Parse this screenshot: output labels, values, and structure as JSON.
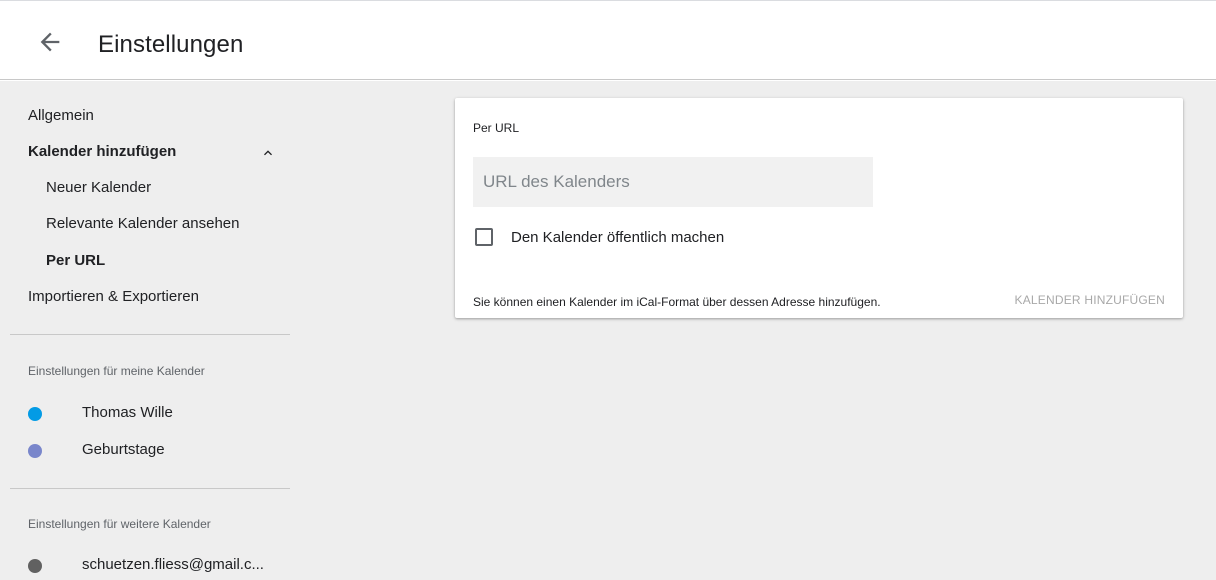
{
  "header": {
    "back_icon": "arrow-back-icon",
    "title": "Einstellungen"
  },
  "sidebar": {
    "items": [
      {
        "label": "Allgemein"
      },
      {
        "label": "Kalender hinzufügen"
      },
      {
        "label": "Neuer Kalender"
      },
      {
        "label": "Relevante Kalender ansehen"
      },
      {
        "label": "Per URL"
      },
      {
        "label": "Importieren & Exportieren"
      }
    ],
    "my_calendars_title": "Einstellungen für meine Kalender",
    "my_calendars": [
      {
        "name": "Thomas Wille",
        "color": "#039be5"
      },
      {
        "name": "Geburtstage",
        "color": "#7986cb"
      }
    ],
    "other_calendars_title": "Einstellungen für weitere Kalender",
    "other_calendars": [
      {
        "name": "schuetzen.fliess@gmail.c...",
        "color": "#616161"
      }
    ]
  },
  "card": {
    "title": "Per URL",
    "url_placeholder": "URL des Kalenders",
    "url_value": "",
    "public_checkbox_label": "Den Kalender öffentlich machen",
    "public_checked": false,
    "description": "Sie können einen Kalender im iCal-Format über dessen Adresse hinzufügen.",
    "add_button_label": "KALENDER HINZUFÜGEN"
  }
}
